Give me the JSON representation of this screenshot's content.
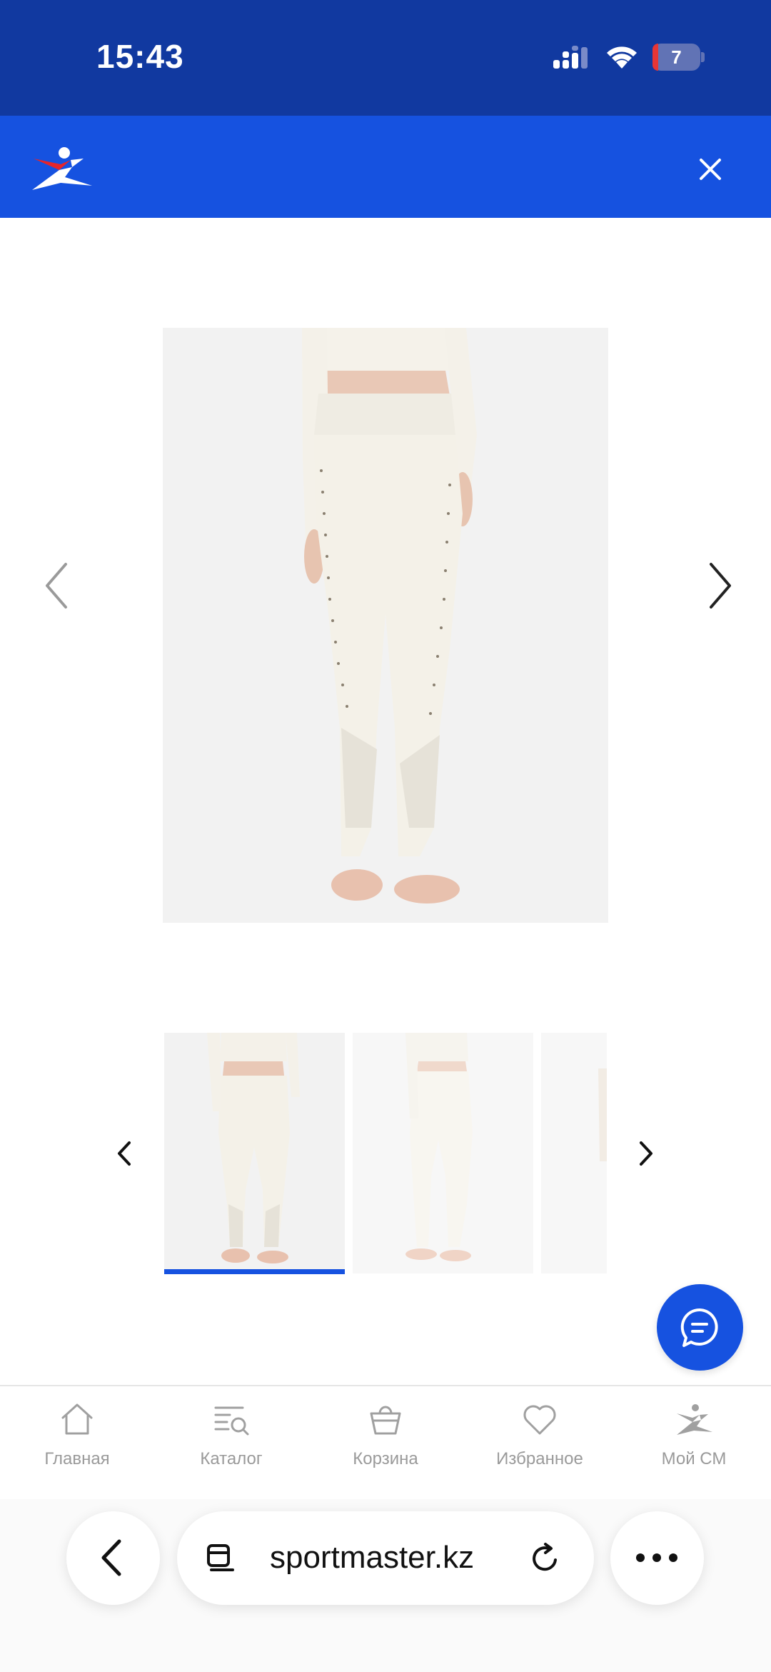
{
  "status_bar": {
    "time": "15:43",
    "battery_level": "7",
    "background": "#1139a0"
  },
  "app_header": {
    "background": "#1652e0",
    "logo_icon": "sportmaster-logo-icon",
    "close_icon": "close-icon"
  },
  "gallery": {
    "main_image": "product-leggings-front",
    "prev_icon": "chevron-left-icon",
    "next_icon": "chevron-right-icon",
    "thumbnails": [
      "leggings-front",
      "leggings-side",
      "leggings-back"
    ],
    "active_thumbnail": 0
  },
  "chat_fab": {
    "icon": "chat-bubble-icon"
  },
  "bottom_nav": {
    "items": [
      {
        "label": "Главная",
        "icon": "home-icon"
      },
      {
        "label": "Каталог",
        "icon": "catalog-search-icon"
      },
      {
        "label": "Корзина",
        "icon": "basket-icon"
      },
      {
        "label": "Избранное",
        "icon": "heart-icon"
      },
      {
        "label": "Мой СМ",
        "icon": "profile-runner-icon"
      }
    ]
  },
  "browser": {
    "url": "sportmaster.kz",
    "back_icon": "chevron-left-icon",
    "reader_icon": "reader-icon",
    "reload_icon": "reload-icon",
    "more_icon": "more-dots-icon"
  }
}
